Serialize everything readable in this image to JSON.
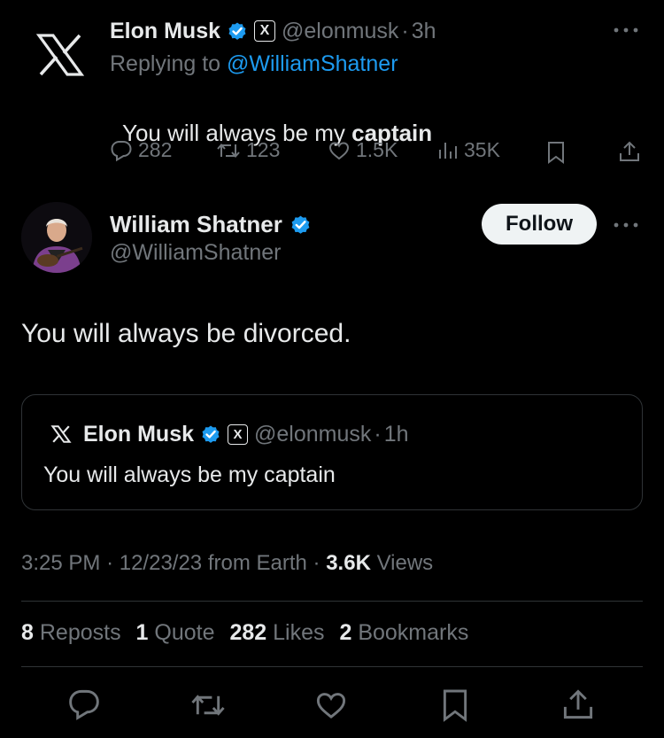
{
  "reply_tweet": {
    "author_name": "Elon Musk",
    "handle": "@elonmusk",
    "separator": "·",
    "time": "3h",
    "replying_prefix": "Replying to",
    "replying_to": "@WilliamShatner",
    "text_plain": "You will always be my ",
    "text_bold": "captain",
    "stats": {
      "replies": "282",
      "reposts": "123",
      "likes": "1.5K",
      "views": "35K"
    }
  },
  "main_tweet": {
    "author_name": "William Shatner",
    "handle": "@WilliamShatner",
    "follow_label": "Follow",
    "text": "You will always be divorced.",
    "quote": {
      "author_name": "Elon Musk",
      "handle": "@elonmusk",
      "separator": "·",
      "time": "1h",
      "text": "You will always be my captain"
    },
    "meta": {
      "time": "3:25 PM",
      "dot1": "·",
      "date": "12/23/23",
      "source": "from Earth",
      "dot2": "·",
      "views_count": "3.6K",
      "views_label": "Views"
    },
    "engagement": {
      "reposts_count": "8",
      "reposts_label": "Reposts",
      "quotes_count": "1",
      "quotes_label": "Quote",
      "likes_count": "282",
      "likes_label": "Likes",
      "bookmarks_count": "2",
      "bookmarks_label": "Bookmarks"
    }
  },
  "badge_x_glyph": "X",
  "colors": {
    "background": "#000000",
    "text": "#e7e9ea",
    "muted": "#71767b",
    "link": "#1d9bf0",
    "verified": "#1d9bf0",
    "border": "#2f3336"
  },
  "icons": [
    "x-logo-icon",
    "verified-icon",
    "more-icon",
    "reply-icon",
    "repost-icon",
    "like-icon",
    "views-icon",
    "bookmark-icon",
    "share-icon"
  ]
}
